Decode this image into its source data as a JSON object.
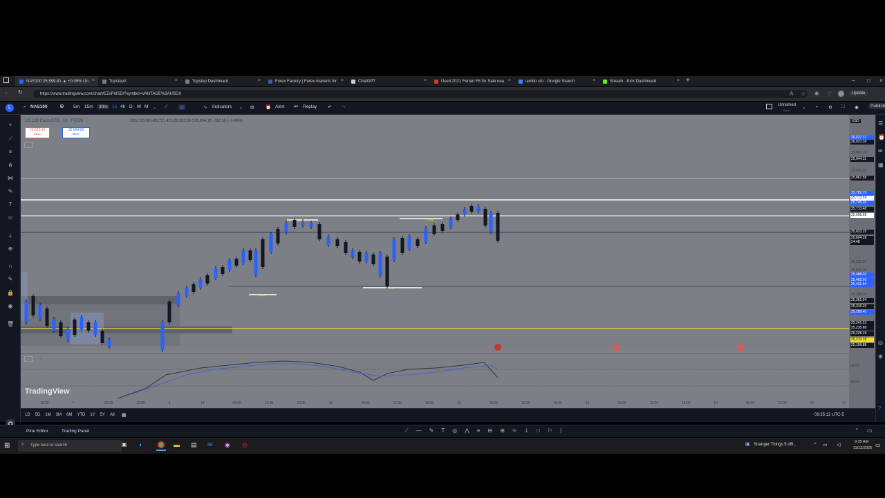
{
  "browser": {
    "tabs": [
      {
        "title": "NAS100 25,599.81 ▲ +0.09% Un",
        "active": true,
        "color": "#2962ff"
      },
      {
        "title": "TopstepX",
        "active": false,
        "color": "#7b7d83"
      },
      {
        "title": "Topstep Dashboard",
        "active": false,
        "color": "#7b7d83"
      },
      {
        "title": "Forex Factory | Forex markets for",
        "active": false,
        "color": "#3c5aa8"
      },
      {
        "title": "ChatGPT",
        "active": false,
        "color": "#cfd1d6"
      },
      {
        "title": "Used 2021 Ferrari F8 for Sale nea",
        "active": false,
        "color": "#d43b2f"
      },
      {
        "title": "lambo sto - Google Search",
        "active": false,
        "color": "#4285f4"
      },
      {
        "title": "Stream - Kick Dashboard",
        "active": false,
        "color": "#53fc18"
      }
    ],
    "url": "https://www.tradingview.com/chart/EZxPnlSD/?symbol=VANTAGE%3AUSDX",
    "update_label": "Update"
  },
  "toolbar": {
    "symbol": "NAS100",
    "intervals": [
      "5m",
      "15m",
      "30m",
      "1h",
      "4h",
      "D",
      "W",
      "M"
    ],
    "indicators_label": "Indicators",
    "alert_label": "Alert",
    "replay_label": "Replay",
    "layout_name": "Unnamed",
    "layout_sub": "Save",
    "publish_label": "Publish"
  },
  "legend": {
    "title": "US 100 Cash CFD · 1h · FXCM",
    "ohlc": "O25,720.68 H25,721.43 L25,593.56 C25,604.18 −116.50 (−0.45%)",
    "sell_price": "25,603.06",
    "sell_label": "SELL",
    "buy_price": "25,604.08",
    "buy_label": "BUY",
    "currency": "USD"
  },
  "price_axis": [
    {
      "label": "26,027.17",
      "color": "#2962ff"
    },
    {
      "label": "26,023.38",
      "color": "#131722"
    },
    {
      "label": "25,961.16",
      "color": "#6c6f76"
    },
    {
      "label": "25,944.11",
      "color": "#131722"
    },
    {
      "label": "25,900.00",
      "color": "#6c6f76"
    },
    {
      "label": "25,867.58",
      "color": "#131722"
    },
    {
      "label": "25,782.75",
      "color": "#2962ff"
    },
    {
      "label": "25,773.59",
      "color": "#ffffff"
    },
    {
      "label": "25,745.20",
      "color": "#2962ff"
    },
    {
      "label": "25,713.48",
      "color": "#131722"
    },
    {
      "label": "25,698.68",
      "color": "#ffffff"
    },
    {
      "label": "25,633.15",
      "color": "#131722"
    },
    {
      "label": "25,604.18",
      "color": "#131722"
    },
    {
      "label": "24:48",
      "color": "#131722"
    },
    {
      "label": "25,550.00",
      "color": "#6c6f76"
    },
    {
      "label": "25,500.00",
      "color": "#6c6f76"
    },
    {
      "label": "25,488.60",
      "color": "#2962ff"
    },
    {
      "label": "25,462.90",
      "color": "#2962ff"
    },
    {
      "label": "25,431.54",
      "color": "#2962ff"
    },
    {
      "label": "25,398.38",
      "color": "#6c6f76"
    },
    {
      "label": "25,361.04",
      "color": "#131722"
    },
    {
      "label": "25,316.20",
      "color": "#131722"
    },
    {
      "label": "25,289.40",
      "color": "#2962ff"
    },
    {
      "label": "25,241.23",
      "color": "#131722"
    },
    {
      "label": "25,235.68",
      "color": "#131722"
    },
    {
      "label": "25,228.19",
      "color": "#131722"
    },
    {
      "label": "25,210.28",
      "color": "#f0e020"
    },
    {
      "label": "25,196.88",
      "color": "#131722"
    }
  ],
  "time_axis": [
    "18:00",
    "7",
    "06:00",
    "12:00",
    "9",
    "10",
    "06:00",
    "12:00",
    "18:00",
    "11",
    "06:00",
    "12:00",
    "18:00",
    "12",
    "06:00",
    "12:00",
    "18:00",
    "13",
    "06:00",
    "12:00",
    "18:00",
    "14",
    "06:00",
    "12:00",
    "16",
    "17"
  ],
  "watermark": "TradingView",
  "pattern_labels": [
    "p.hod",
    "hod",
    "p.lod",
    "lod"
  ],
  "indicator_levels": [
    "60.00",
    "40.00"
  ],
  "ranges": [
    "1D",
    "5D",
    "1M",
    "3M",
    "6M",
    "YTD",
    "1Y",
    "5Y",
    "All"
  ],
  "clock": "09:35:12 UTC-5",
  "panels": {
    "pine": "Pine Editor",
    "trading": "Trading Panel"
  },
  "taskbar": {
    "search_placeholder": "Type here to search",
    "media": "Stranger Things 5 offi...",
    "time": "9:35 AM",
    "date": "11/12/2025"
  }
}
